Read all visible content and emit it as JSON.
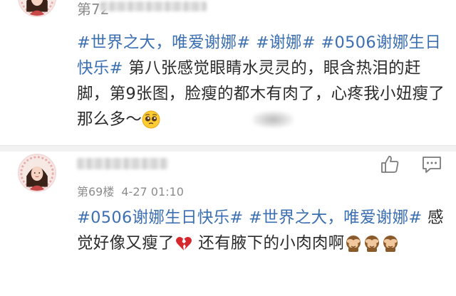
{
  "posts": [
    {
      "floor_label": "第72",
      "content": {
        "tags": [
          "#世界之大，唯爱谢娜#",
          "#谢娜#",
          "#0506谢娜生日快乐#"
        ],
        "text": "第八张感觉眼睛水灵灵的，眼含热泪的赶脚，第9张图，脸瘦的都木有肉了，心疼我小妞瘦了那么多～",
        "emoji": "pleading-face-icon"
      }
    },
    {
      "floor_label": "第69楼",
      "time": "4-27 01:10",
      "content": {
        "tags": [
          "#0506谢娜生日快乐#",
          "#世界之大，唯爱谢娜#"
        ],
        "text_before": "感觉好像又瘦了",
        "text_after": "还有腋下的小肉肉啊",
        "emojis": [
          "broken-heart-icon",
          "see-no-evil-monkey-icon",
          "see-no-evil-monkey-icon",
          "see-no-evil-monkey-icon"
        ]
      },
      "actions": [
        "like-icon",
        "comment-icon"
      ]
    }
  ],
  "colors": {
    "tag": "#3b6fb2",
    "text": "#2b2b2b",
    "meta": "#8c8c8c",
    "divider": "#f2f2f2"
  }
}
